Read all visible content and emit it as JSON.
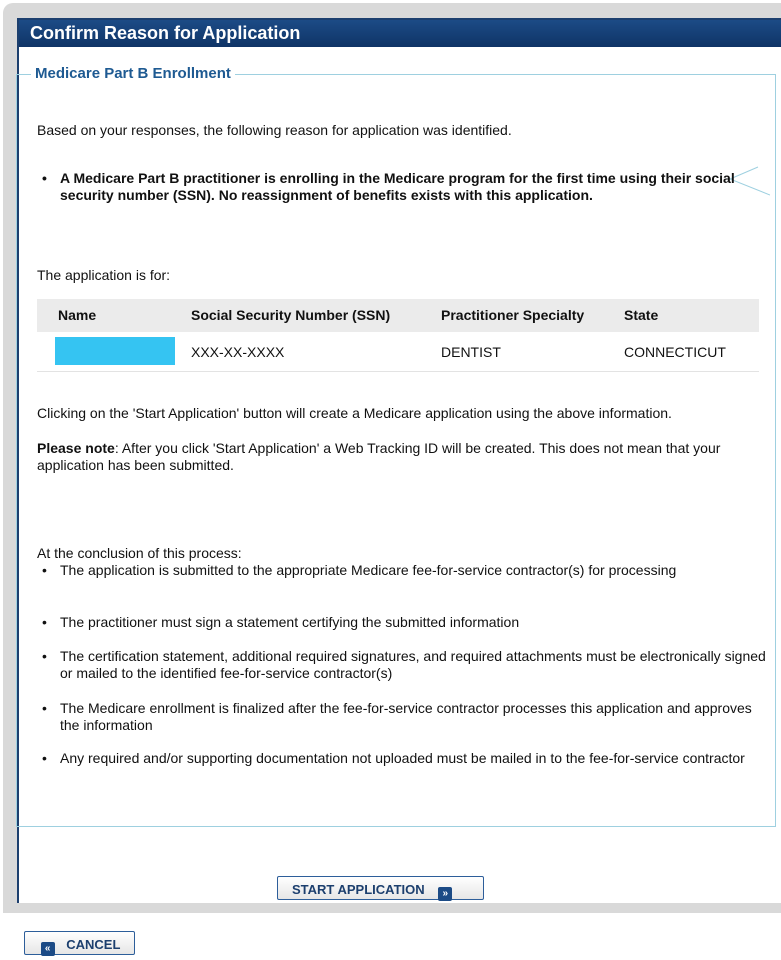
{
  "header": {
    "title": "Confirm Reason for Application"
  },
  "section": {
    "legend": "Medicare Part B Enrollment",
    "intro": "Based on your responses, the following reason for application was identified.",
    "reason": "A Medicare Part B practitioner is enrolling in the Medicare program for the first time using their social security number (SSN). No reassignment of benefits exists with this application.",
    "application_for": "The application is for:"
  },
  "table": {
    "columns": [
      "Name",
      "Social Security Number (SSN)",
      "Practitioner Specialty",
      "State"
    ],
    "rows": [
      {
        "name": "",
        "ssn": "XXX-XX-XXXX",
        "specialty": "DENTIST",
        "state": "CONNECTICUT"
      }
    ]
  },
  "info": {
    "start_text": "Clicking on the 'Start Application' button will create a Medicare application using the above information.",
    "note_label": "Please note",
    "note_text": ": After you click 'Start Application' a Web Tracking ID will be created. This does not mean that your application has been submitted.",
    "conclusion_intro": "At the conclusion of this process:",
    "conclusion_items": [
      "The application is submitted to the appropriate Medicare fee-for-service contractor(s) for processing",
      "The practitioner must sign a statement certifying the submitted information",
      "The certification statement, additional required signatures, and required attachments must be electronically signed or mailed to the identified fee-for-service contractor(s)",
      "The Medicare enrollment is finalized after the fee-for-service contractor processes this application and approves the information",
      "Any required and/or supporting documentation not uploaded must be mailed in to the fee-for-service contractor"
    ]
  },
  "buttons": {
    "start_label": "START APPLICATION",
    "cancel_label": "CANCEL"
  },
  "colors": {
    "header_bg": "#1c4b86",
    "legend_text": "#1e5a92",
    "section_border": "#9ed0e0",
    "redaction": "#35c4f2"
  }
}
